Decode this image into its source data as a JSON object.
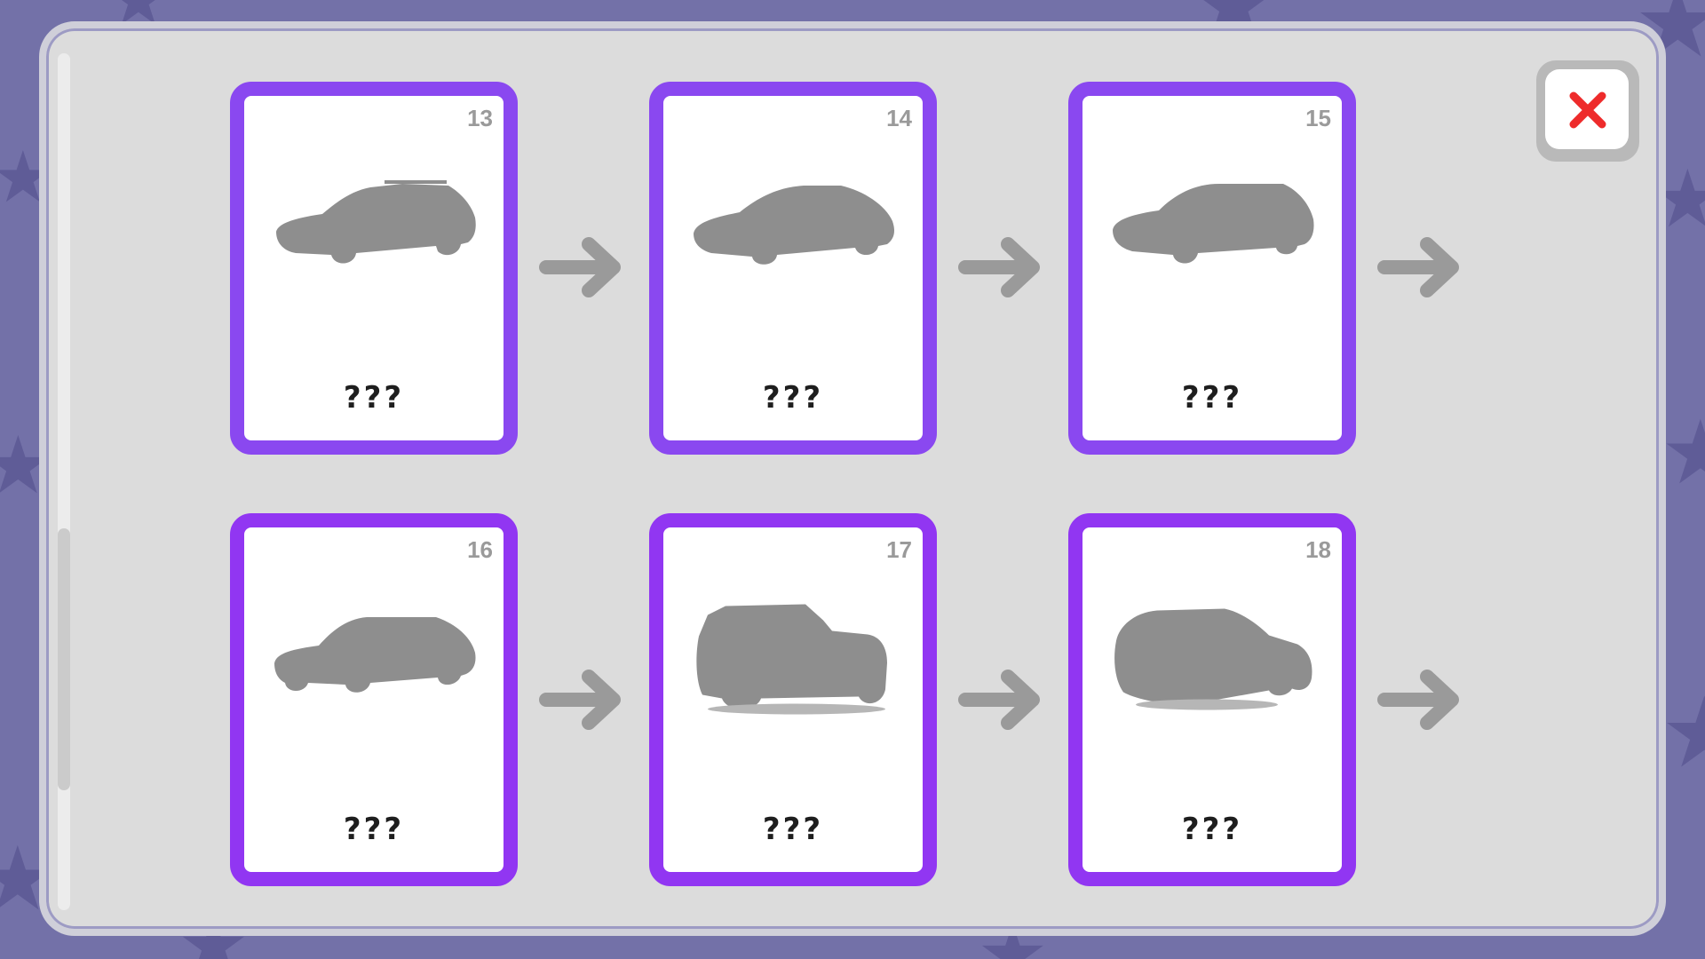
{
  "dialog": {
    "close_icon": "close-x-icon",
    "close_color": "#ee2b2b"
  },
  "cards": [
    {
      "number": "13",
      "name": "???",
      "silhouette": "station-wagon-silhouette"
    },
    {
      "number": "14",
      "name": "???",
      "silhouette": "hatchback-silhouette"
    },
    {
      "number": "15",
      "name": "???",
      "silhouette": "compact-suv-silhouette"
    },
    {
      "number": "16",
      "name": "???",
      "silhouette": "suv-silhouette"
    },
    {
      "number": "17",
      "name": "???",
      "silhouette": "offroad-suv-silhouette"
    },
    {
      "number": "18",
      "name": "???",
      "silhouette": "crossover-silhouette"
    }
  ],
  "arrows": [
    "next-arrow-icon",
    "next-arrow-icon",
    "next-arrow-icon",
    "next-arrow-icon",
    "next-arrow-icon",
    "next-arrow-icon"
  ],
  "colors": {
    "card_border_row1": "#8a48f0",
    "card_border_row2": "#9136f2",
    "silhouette": "#8e8e8e",
    "arrow": "#9a9a9a",
    "panel": "#dcdcdc",
    "background": "#7371a8"
  }
}
